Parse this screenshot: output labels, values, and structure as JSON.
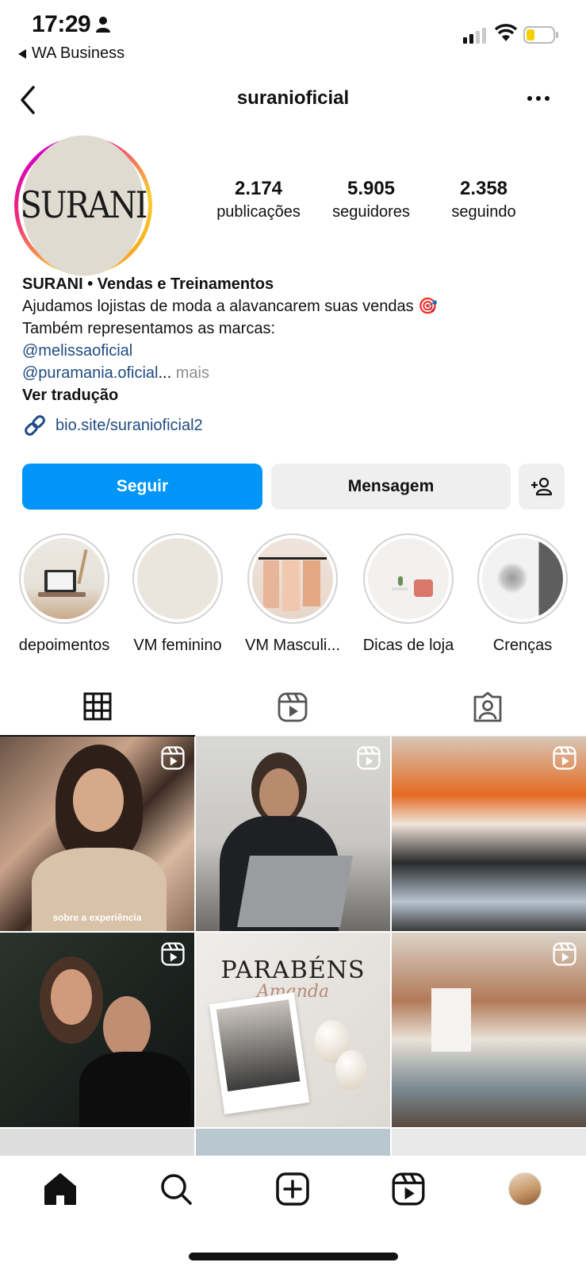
{
  "status_bar": {
    "time": "17:29",
    "back_app": "WA Business"
  },
  "nav": {
    "username": "suranioficial"
  },
  "profile": {
    "avatar_text": "SURANI",
    "stats": [
      {
        "value": "2.174",
        "label": "publicações"
      },
      {
        "value": "5.905",
        "label": "seguidores"
      },
      {
        "value": "2.358",
        "label": "seguindo"
      }
    ],
    "name": "SURANI • Vendas e Treinamentos",
    "bio_line1": "Ajudamos lojistas de moda a alavancarem suas vendas 🎯",
    "bio_line2": "Também representamos as marcas:",
    "mention1": "@melissaoficial",
    "mention2": "@puramania.oficial",
    "ellipsis": "...",
    "more": "mais",
    "translate": "Ver tradução",
    "link": "bio.site/suranioficial2"
  },
  "actions": {
    "follow": "Seguir",
    "message": "Mensagem"
  },
  "highlights": [
    {
      "label": "depoimentos"
    },
    {
      "label": "VM feminino"
    },
    {
      "label": "VM Masculi..."
    },
    {
      "label": "Dicas de loja"
    },
    {
      "label": "Crenças"
    }
  ],
  "posts": {
    "caption1": "sobre a experiência",
    "parabens_title": "PARABÉNS",
    "parabens_name": "Amanda"
  },
  "colors": {
    "accent": "#0095f6",
    "link": "#1f4b82"
  }
}
